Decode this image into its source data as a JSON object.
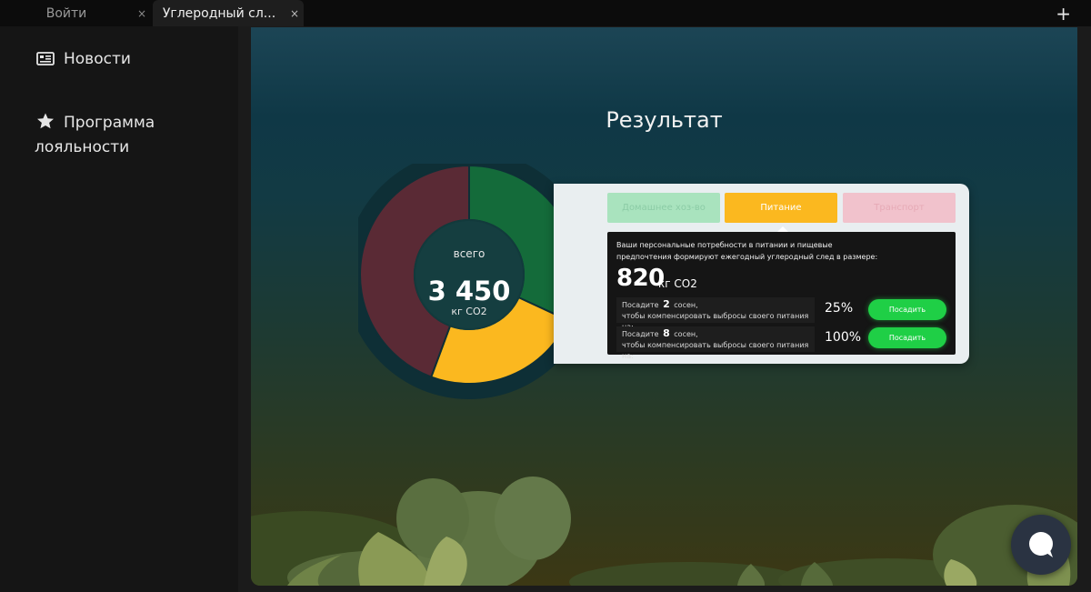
{
  "browser": {
    "tabs": [
      {
        "label": "Войти",
        "close": "×"
      },
      {
        "label": "Углеродный сл...",
        "close": "×"
      }
    ],
    "new_tab": "+"
  },
  "sidebar": {
    "items": [
      {
        "label": "Новости",
        "icon": "newspaper-icon"
      },
      {
        "label": "Программа лояльности",
        "icon": "star-icon"
      }
    ]
  },
  "page": {
    "title": "Результат"
  },
  "donut": {
    "total_label": "всего",
    "total_value": "3 450",
    "total_unit": "кг CO2",
    "segments": [
      {
        "value": 1100,
        "color": "#146b3a"
      },
      {
        "value": 820,
        "color": "#fbb81f"
      },
      {
        "value": 1530,
        "color": "#5a2a35"
      }
    ]
  },
  "card": {
    "tabs": [
      "Домашнее хоз-во",
      "Питание",
      "Транспорт"
    ],
    "description": "Ваши персональные потребности в питании и пищевые предпочтения формируют ежегодный углеродный след в размере:",
    "value": "820",
    "unit": "кг CO2",
    "rows": [
      {
        "prefix": "Посадите",
        "count": "2",
        "suffix": "сосен,",
        "line2": "чтобы компенсировать выбросы своего питания на:",
        "percent": "25%",
        "button": "Посадить"
      },
      {
        "prefix": "Посадите",
        "count": "8",
        "suffix": "сосен,",
        "line2": "чтобы компенсировать выбросы своего питания на:",
        "percent": "100%",
        "button": "Посадить"
      }
    ]
  },
  "colors": {
    "accent_green": "#1fcf46",
    "food_tab": "#fbb81f"
  }
}
